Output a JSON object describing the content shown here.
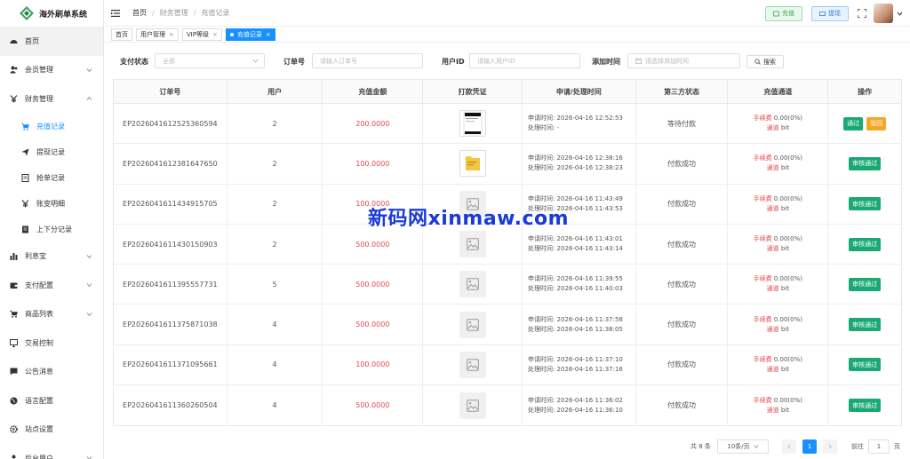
{
  "app": {
    "title": "海外刷单系统"
  },
  "sidebar": {
    "items": [
      {
        "label": "首页",
        "icon": "dashboard-icon"
      },
      {
        "label": "会员管理",
        "icon": "users-icon"
      },
      {
        "label": "财务管理",
        "icon": "yen-icon"
      },
      {
        "label": "利息宝",
        "icon": "bar-chart-icon"
      },
      {
        "label": "支付配置",
        "icon": "wallet-icon"
      },
      {
        "label": "商品列表",
        "icon": "cart-icon"
      },
      {
        "label": "交易控制",
        "icon": "monitor-icon"
      },
      {
        "label": "公告消息",
        "icon": "message-icon"
      },
      {
        "label": "语言配置",
        "icon": "globe-icon"
      },
      {
        "label": "站点设置",
        "icon": "gear-icon"
      },
      {
        "label": "后台用户",
        "icon": "user-icon"
      }
    ],
    "finance_sub": [
      {
        "label": "充值记录"
      },
      {
        "label": "提现记录"
      },
      {
        "label": "抢单记录"
      },
      {
        "label": "账变明细"
      },
      {
        "label": "上下分记录"
      }
    ]
  },
  "header": {
    "breadcrumb": [
      "首页",
      "财务管理",
      "充值记录"
    ],
    "recharge_label": "充值",
    "withdraw_label": "提现"
  },
  "tabs": [
    {
      "label": "首页"
    },
    {
      "label": "用户管理"
    },
    {
      "label": "VIP等级"
    },
    {
      "label": "充值记录"
    }
  ],
  "filters": {
    "status_label": "支付状态",
    "status_value": "全部",
    "order_label": "订单号",
    "order_placeholder": "请输入订单号",
    "uid_label": "用户ID",
    "uid_placeholder": "请输入用户ID",
    "time_label": "添加时间",
    "time_placeholder": "请选择添加时间",
    "search_label": "搜索"
  },
  "table": {
    "headers": [
      "订单号",
      "用户",
      "充值金额",
      "打款凭证",
      "申请/处理时间",
      "第三方状态",
      "充值通道",
      "操作"
    ],
    "rows": [
      {
        "order": "EP2026041612525360594",
        "user": "2",
        "amount": "200.0000",
        "apply": "申请时间: 2026-04-16 12:52:53",
        "process": "处理时间: -",
        "status": "等待付款",
        "fee_k": "手续费",
        "fee_v": "0.00(0%)",
        "ch_k": "通道",
        "ch_v": "bit",
        "voucher": "phone",
        "ops": [
          "通过",
          "驳回"
        ]
      },
      {
        "order": "EP2026041612381647650",
        "user": "2",
        "amount": "100.0000",
        "apply": "申请时间: 2026-04-16 12:38:16",
        "process": "处理时间: 2026-04-16 12:38:23",
        "status": "付款成功",
        "fee_k": "手续费",
        "fee_v": "0.00(0%)",
        "ch_k": "通道",
        "ch_v": "bit",
        "voucher": "folder",
        "ops": [
          "审核通过"
        ]
      },
      {
        "order": "EP2026041611434915705",
        "user": "2",
        "amount": "100.0000",
        "apply": "申请时间: 2026-04-16 11:43:49",
        "process": "处理时间: 2026-04-16 11:43:53",
        "status": "付款成功",
        "fee_k": "手续费",
        "fee_v": "0.00(0%)",
        "ch_k": "通道",
        "ch_v": "bit",
        "voucher": "placeholder",
        "ops": [
          "审核通过"
        ]
      },
      {
        "order": "EP2026041611430150903",
        "user": "2",
        "amount": "500.0000",
        "apply": "申请时间: 2026-04-16 11:43:01",
        "process": "处理时间: 2026-04-16 11:43:14",
        "status": "付款成功",
        "fee_k": "手续费",
        "fee_v": "0.00(0%)",
        "ch_k": "通道",
        "ch_v": "bit",
        "voucher": "placeholder",
        "ops": [
          "审核通过"
        ]
      },
      {
        "order": "EP2026041611395557731",
        "user": "5",
        "amount": "500.0000",
        "apply": "申请时间: 2026-04-16 11:39:55",
        "process": "处理时间: 2026-04-16 11:40:03",
        "status": "付款成功",
        "fee_k": "手续费",
        "fee_v": "0.00(0%)",
        "ch_k": "通道",
        "ch_v": "bit",
        "voucher": "placeholder",
        "ops": [
          "审核通过"
        ]
      },
      {
        "order": "EP2026041611375871038",
        "user": "4",
        "amount": "500.0000",
        "apply": "申请时间: 2026-04-16 11:37:58",
        "process": "处理时间: 2026-04-16 11:38:05",
        "status": "付款成功",
        "fee_k": "手续费",
        "fee_v": "0.00(0%)",
        "ch_k": "通道",
        "ch_v": "bit",
        "voucher": "placeholder",
        "ops": [
          "审核通过"
        ]
      },
      {
        "order": "EP2026041611371095661",
        "user": "4",
        "amount": "100.0000",
        "apply": "申请时间: 2026-04-16 11:37:10",
        "process": "处理时间: 2026-04-16 11:37:16",
        "status": "付款成功",
        "fee_k": "手续费",
        "fee_v": "0.00(0%)",
        "ch_k": "通道",
        "ch_v": "bit",
        "voucher": "placeholder",
        "ops": [
          "审核通过"
        ]
      },
      {
        "order": "EP2026041611360260504",
        "user": "4",
        "amount": "500.0000",
        "apply": "申请时间: 2026-04-16 11:36:02",
        "process": "处理时间: 2026-04-16 11:36:10",
        "status": "付款成功",
        "fee_k": "手续费",
        "fee_v": "0.00(0%)",
        "ch_k": "通道",
        "ch_v": "bit",
        "voucher": "placeholder",
        "ops": [
          "审核通过"
        ]
      }
    ]
  },
  "pager": {
    "total": "共 8 条",
    "page_size": "10条/页",
    "current": "1",
    "goto_label": "前往",
    "goto_value": "1",
    "page_suffix": "页"
  },
  "watermark": "新码网xinmaw.com",
  "colors": {
    "primary": "#1890ff",
    "success": "#19a974",
    "warning": "#f5a623",
    "danger": "#e5484d"
  }
}
